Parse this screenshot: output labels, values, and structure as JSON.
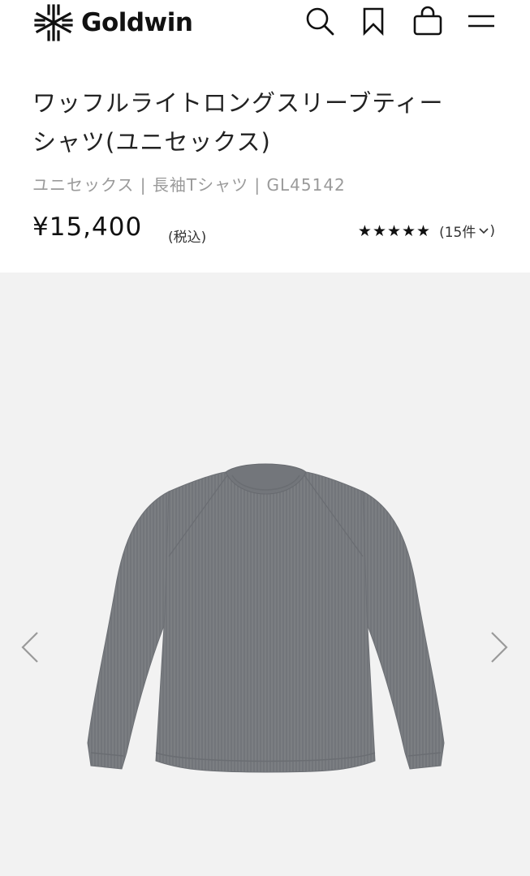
{
  "brand": {
    "name": "Goldwin"
  },
  "header_icons": [
    "search-icon",
    "bookmark-icon",
    "bag-icon",
    "menu-icon"
  ],
  "product": {
    "title_line1": "ワッフルライトロングスリーブティー",
    "title_line2": "シャツ(ユニセックス)",
    "meta": "ユニセックス | 長袖Tシャツ | GL45142",
    "price": "¥15,400",
    "tax_note": "(税込)",
    "rating_stars": "★★★★★",
    "review_count": "(15件"
  },
  "gallery": {
    "background": "#f2f2f2",
    "garment_color": "#7b7e82"
  }
}
